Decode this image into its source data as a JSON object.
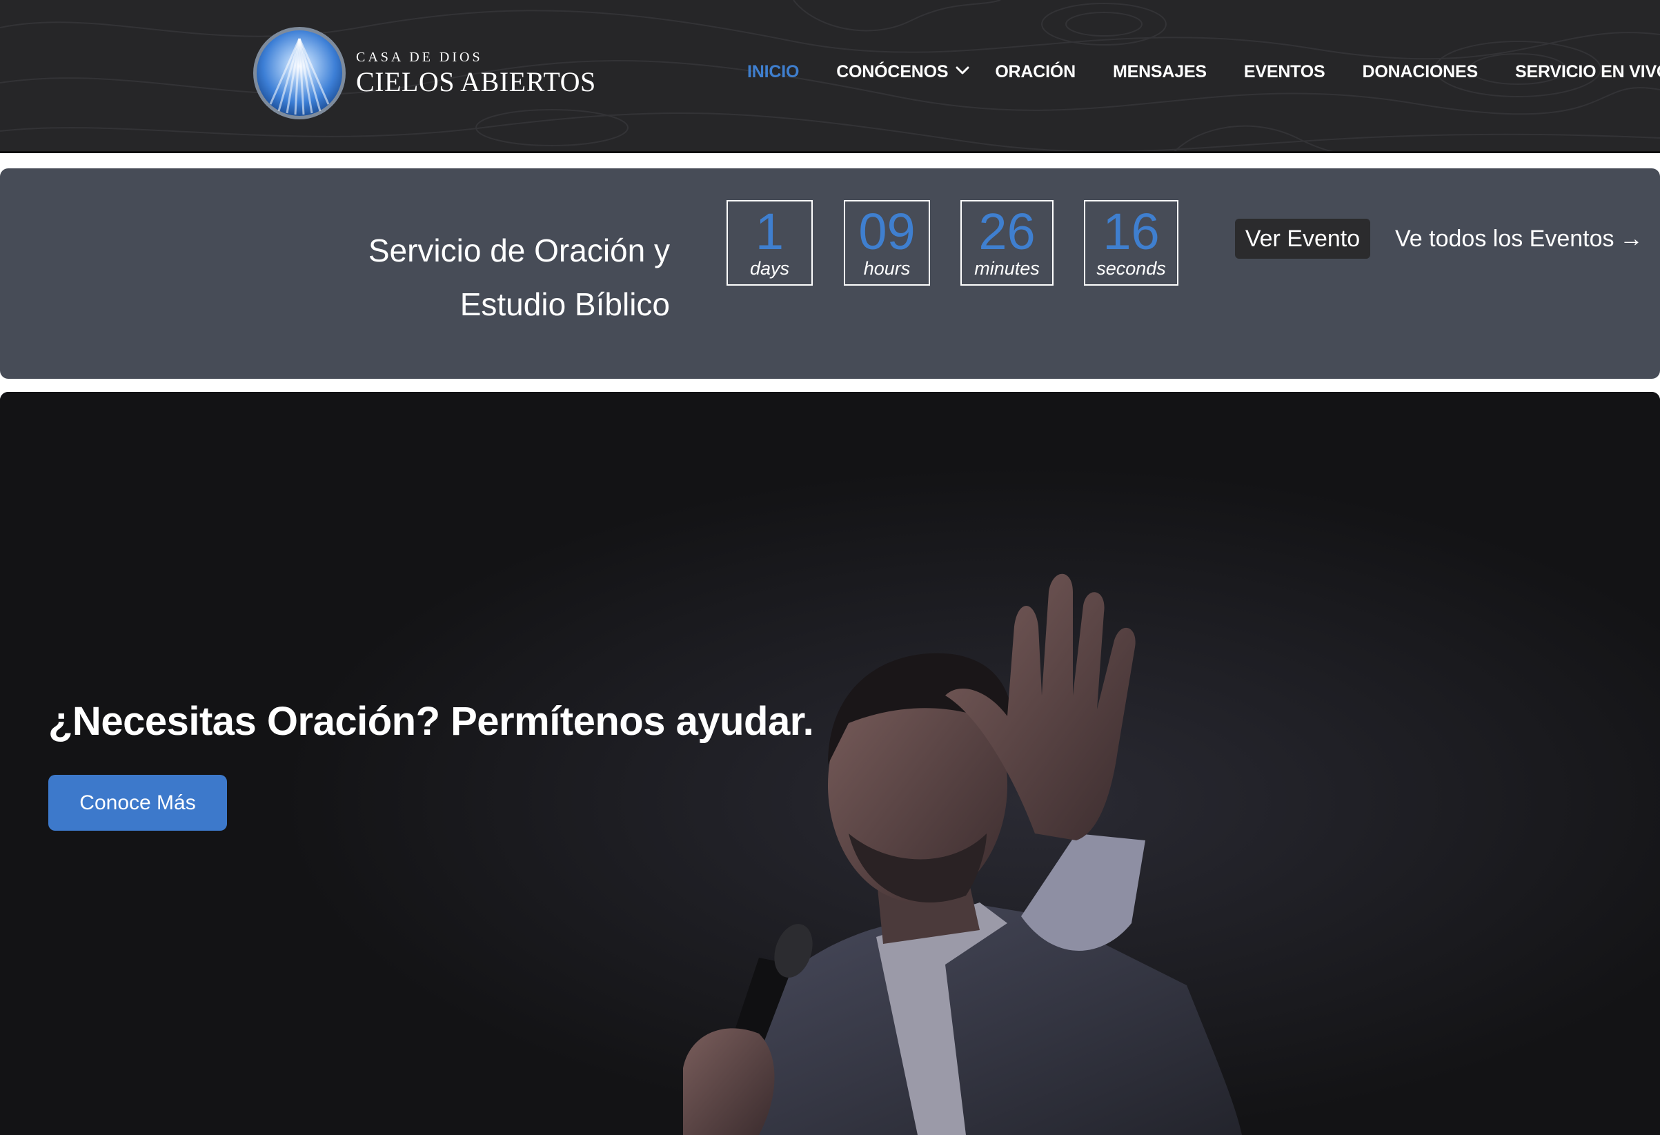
{
  "brand": {
    "line1": "CASA DE DIOS",
    "line2": "CIELOS ABIERTOS",
    "emblem_icon": "blue-sphere-rays-logo",
    "accent": "#3f7fcf"
  },
  "nav": {
    "items": [
      {
        "label": "INICIO",
        "active": true
      },
      {
        "label": "CONÓCENOS",
        "has_dropdown": true
      },
      {
        "label": "ORACIÓN"
      },
      {
        "label": "MENSAJES"
      },
      {
        "label": "EVENTOS"
      },
      {
        "label": "DONACIONES"
      },
      {
        "label": "SERVICIO EN VIVO"
      }
    ],
    "dropdown_icon": "chevron-down-icon"
  },
  "countdown": {
    "event_title_line1": "Servicio de Oración y",
    "event_title_line2": "Estudio Bíblico",
    "units": [
      {
        "value": "1",
        "label": "days"
      },
      {
        "value": "09",
        "label": "hours"
      },
      {
        "value": "26",
        "label": "minutes"
      },
      {
        "value": "16",
        "label": "seconds"
      }
    ],
    "view_event_label": "Ver Evento",
    "all_events_label": "Ve todos los Eventos",
    "all_events_arrow": "→",
    "bar_color": "#474c57"
  },
  "hero": {
    "heading": "¿Necesitas Oración? Permítenos ayudar.",
    "button_label": "Conoce Más",
    "button_color": "#3d79cb",
    "image_subject": "man-praying-with-microphone-raised-hand"
  }
}
